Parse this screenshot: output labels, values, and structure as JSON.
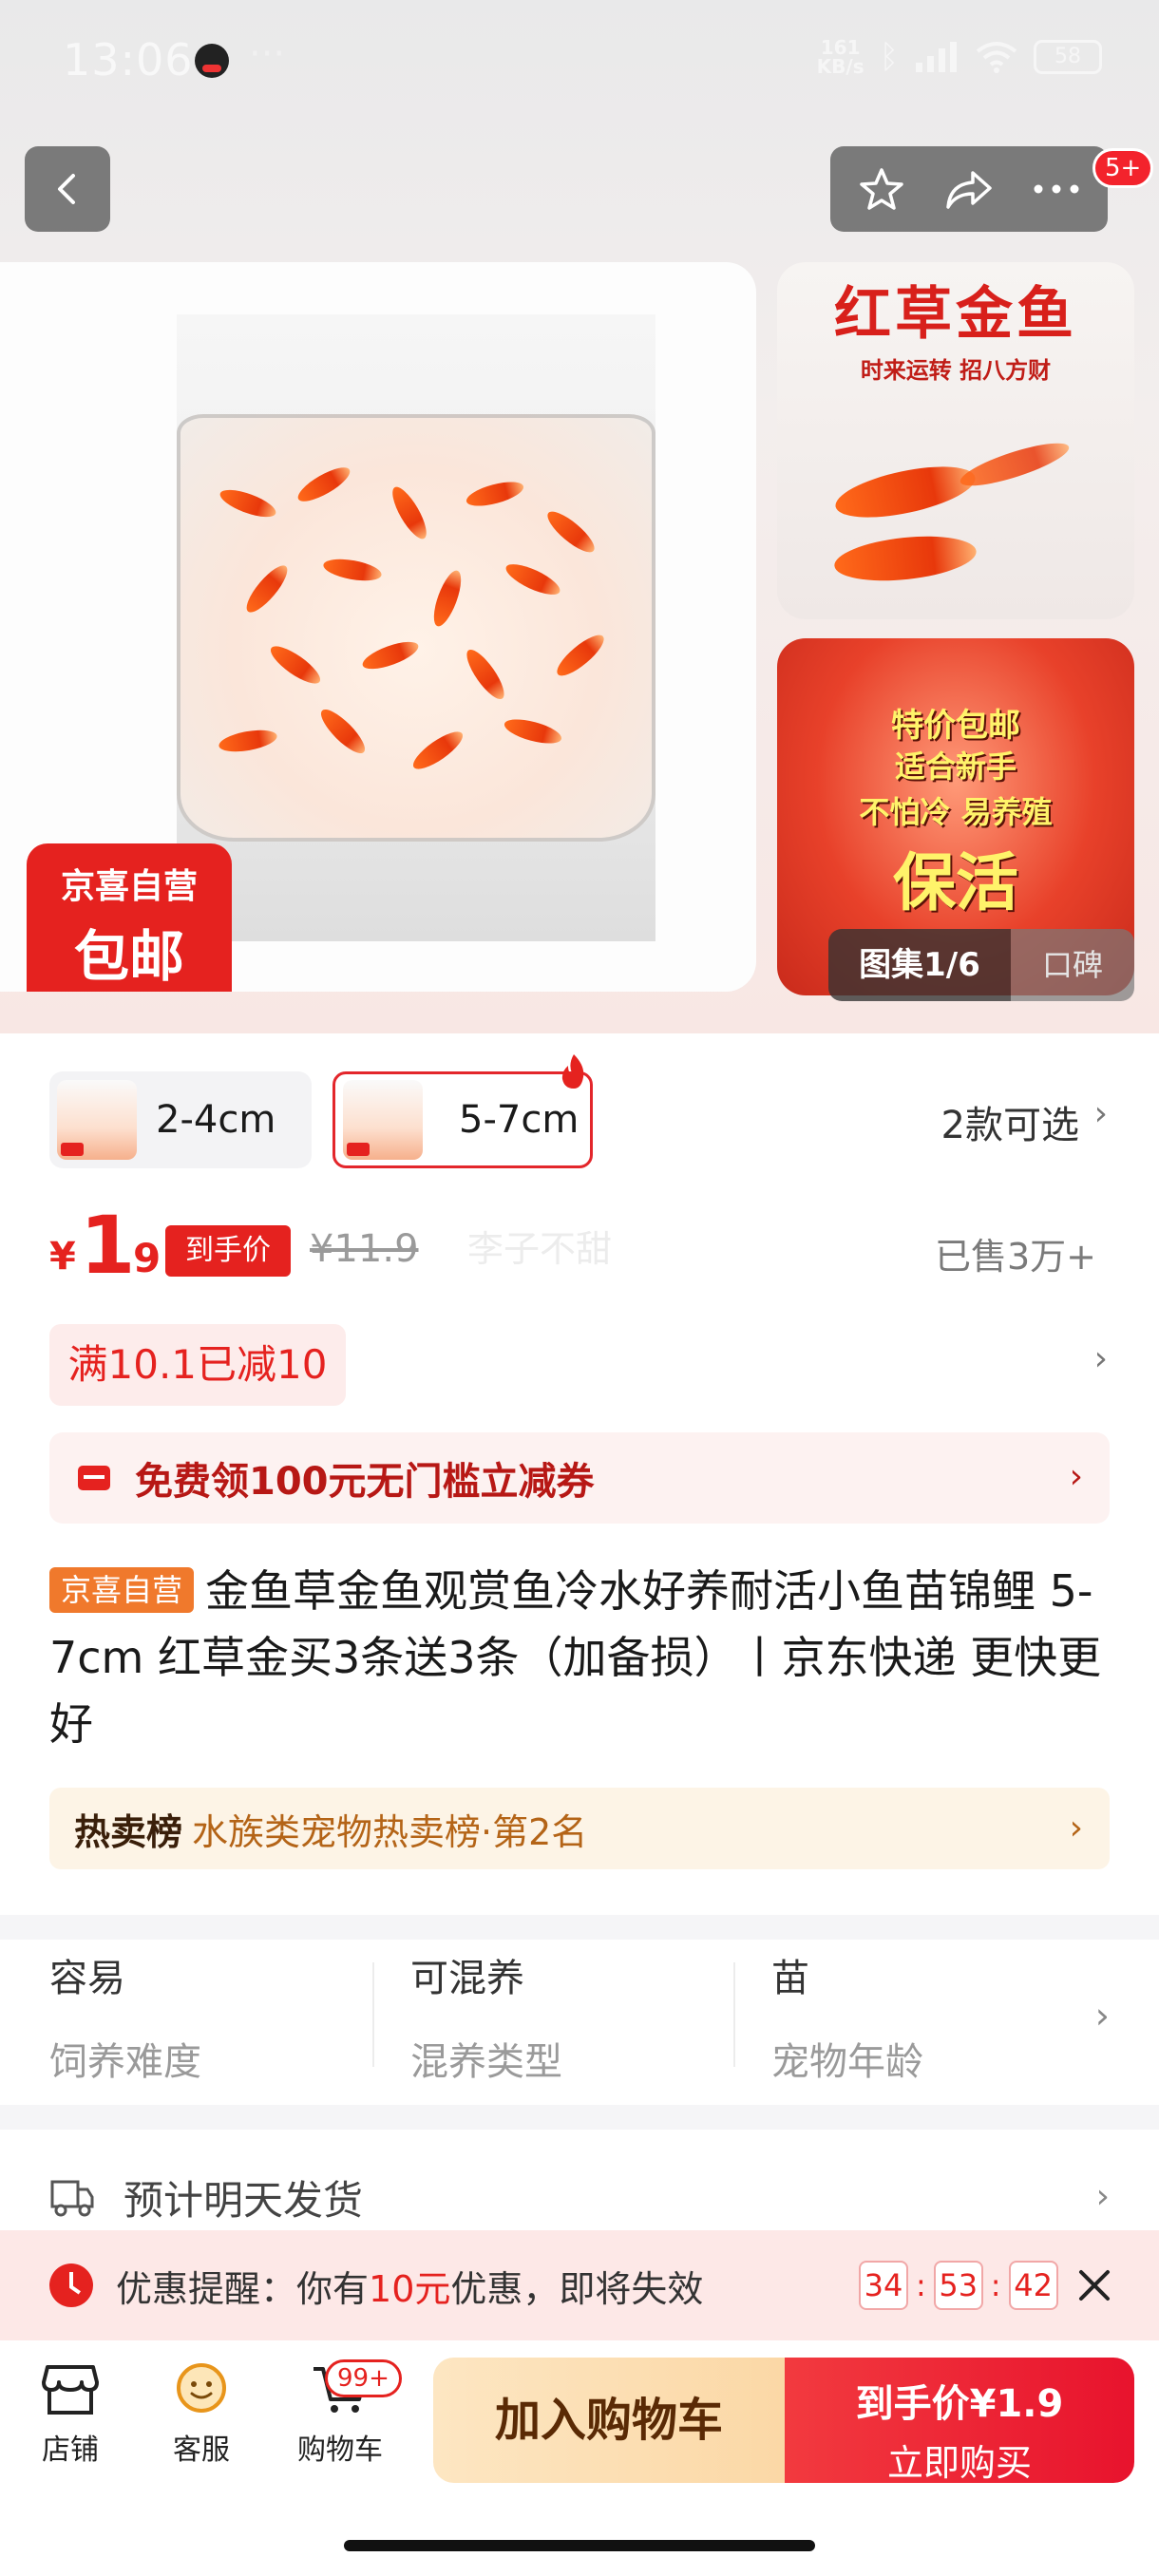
{
  "status": {
    "time": "13:06",
    "dots": "···",
    "speed_value": "161",
    "speed_unit": "KB/s",
    "battery": "58"
  },
  "nav": {
    "badge": "5+"
  },
  "gallery": {
    "sticker_top": "京喜自营",
    "sticker_bottom": "包邮",
    "side_top_headline": "红草金鱼",
    "side_top_sub": "时来运转 招八方财",
    "side_bottom_lines": [
      "特价包邮",
      "适合新手",
      "不怕冷 易养殖",
      "保活"
    ],
    "count": "图集1/6",
    "review": "口碑"
  },
  "variants": {
    "items": [
      {
        "label": "2-4cm"
      },
      {
        "label": "5-7cm"
      }
    ],
    "more": "2款可选"
  },
  "price": {
    "symbol": "¥",
    "int": "1",
    "dec": ".9",
    "tag": "到手价",
    "original": "¥11.9",
    "watermark": "李子不甜",
    "sold": "已售3万+"
  },
  "promo": {
    "text": "满10.1已减10"
  },
  "coupon": {
    "text": "免费领100元无门槛立减券"
  },
  "title": {
    "badge": "京喜自营",
    "text": "金鱼草金鱼观赏鱼冷水好养耐活小鱼苗锦鲤 5-7cm 红草金买3条送3条（加备损）丨京东快递 更快更好"
  },
  "rank": {
    "label": "热卖榜",
    "text": "水族类宠物热卖榜·第2名"
  },
  "attributes": [
    {
      "value": "容易",
      "key": "饲养难度"
    },
    {
      "value": "可混养",
      "key": "混养类型"
    },
    {
      "value": "苗",
      "key": "宠物年龄"
    }
  ],
  "shipping": {
    "text": "预计明天发货"
  },
  "reminder": {
    "prefix": "优惠提醒：你有",
    "amount": "10元",
    "suffix": "优惠，即将失效",
    "hours": "34",
    "minutes": "53",
    "seconds": "42",
    "sep": ":"
  },
  "bottom": {
    "tabs": [
      {
        "label": "店铺"
      },
      {
        "label": "客服"
      },
      {
        "label": "购物车"
      }
    ],
    "cart_badge": "99+",
    "add_to_cart": "加入购物车",
    "buy_line1": "到手价¥1.9",
    "buy_line2": "立即购买"
  },
  "colors": {
    "accent": "#e5221f",
    "cart_button": "#fbd8a6",
    "buy_button": "#e8132d",
    "rank_text": "#b46417"
  },
  "icons": [
    "back-arrow-icon",
    "star-icon",
    "share-icon",
    "more-icon",
    "fire-icon",
    "coupon-icon",
    "truck-icon",
    "clock-icon",
    "close-icon",
    "store-icon",
    "service-icon",
    "cart-icon",
    "chevron-right-icon"
  ]
}
